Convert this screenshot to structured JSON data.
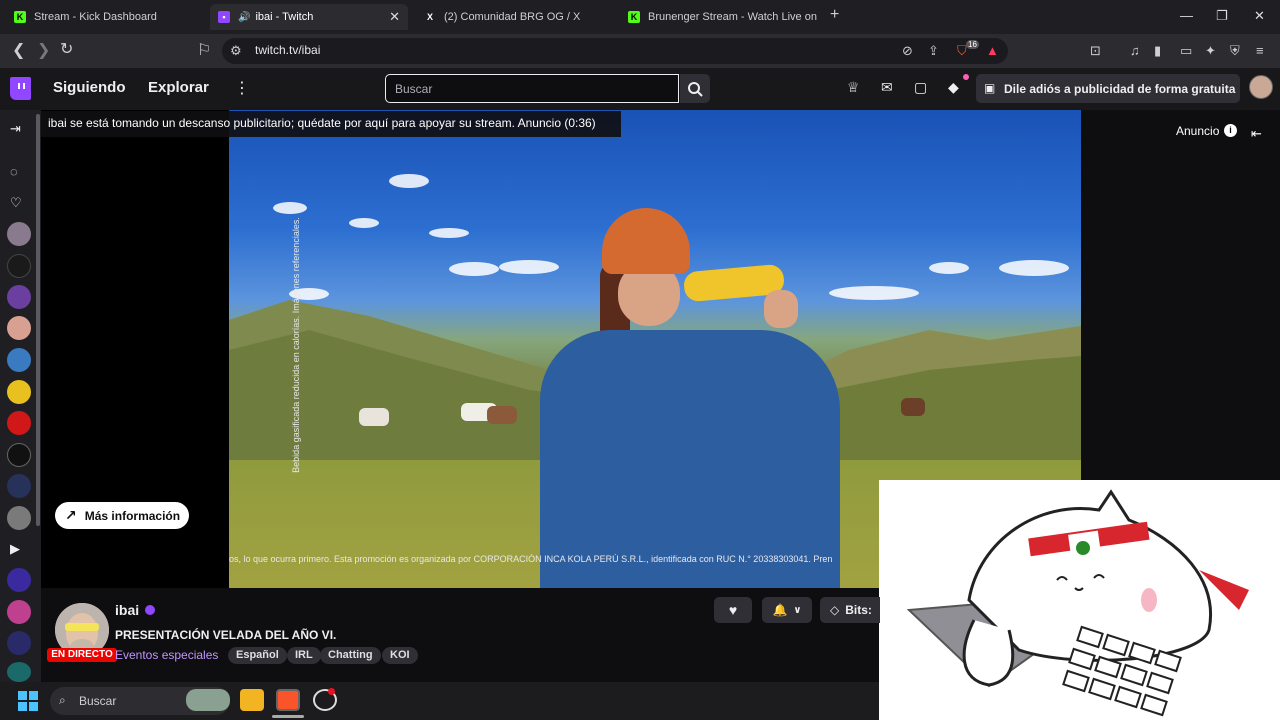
{
  "browser": {
    "tabs": [
      {
        "title": "Stream - Kick Dashboard",
        "favicon": "kick-icon",
        "active": false
      },
      {
        "title": "ibai - Twitch",
        "favicon": "twitch-icon",
        "active": true,
        "audio": true
      },
      {
        "title": "(2) Comunidad BRG OG / X",
        "favicon": "x-icon",
        "active": false
      },
      {
        "title": "Brunenger Stream - Watch Live on Ki",
        "favicon": "kick-icon",
        "active": false
      }
    ],
    "url": "twitch.tv/ibai",
    "shield_count": "16"
  },
  "twitch": {
    "nav": {
      "following": "Siguiendo",
      "explore": "Explorar"
    },
    "search_placeholder": "Buscar",
    "adfree_label": "Dile adiós a publicidad de forma gratuita",
    "colors": {
      "brand": "#9147ff",
      "live": "#eb0400"
    }
  },
  "player": {
    "ad_banner": "ibai se está tomando un descanso publicitario; quédate por aquí para apoyar su stream. Anuncio (0:36)",
    "ad_label": "Anuncio",
    "more_info": "Más información",
    "disclaimer_vertical": "Bebida gasificada reducida en calorías. Imágenes referenciales.",
    "disclaimer_bottom": "os, lo que ocurra primero. Esta promoción es organizada por CORPORACIÓN INCA KOLA PERÚ S.R.L., identificada con RUC N.° 20338303041. Pren"
  },
  "channel": {
    "name": "ibai",
    "live_badge": "EN DIRECTO",
    "title": "PRESENTACIÓN VELADA DEL AÑO VI.",
    "category": "Eventos especiales",
    "tags": [
      "Español",
      "IRL",
      "Chatting",
      "KOI"
    ],
    "bits_label": "Bits:"
  },
  "taskbar": {
    "search_label": "Buscar"
  }
}
